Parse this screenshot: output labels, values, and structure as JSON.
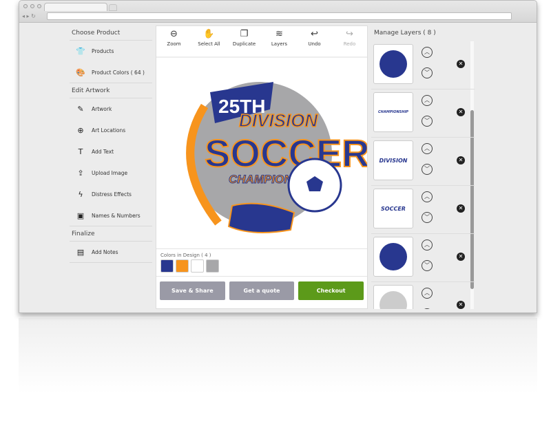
{
  "sidebar": {
    "sections": [
      {
        "title": "Choose Product",
        "items": [
          {
            "label": "Products",
            "icon": "tshirt-icon"
          },
          {
            "label": "Product Colors  ( 64 )",
            "icon": "palette-icon"
          }
        ]
      },
      {
        "title": "Edit Artwork",
        "items": [
          {
            "label": "Artwork",
            "icon": "brush-icon"
          },
          {
            "label": "Art Locations",
            "icon": "crosshair-icon"
          },
          {
            "label": "Add Text",
            "icon": "text-icon"
          },
          {
            "label": "Upload Image",
            "icon": "upload-icon"
          },
          {
            "label": "Distress Effects",
            "icon": "lightning-icon"
          },
          {
            "label": "Names & Numbers",
            "icon": "jersey-icon"
          }
        ]
      },
      {
        "title": "Finalize",
        "items": [
          {
            "label": "Add Notes",
            "icon": "notes-icon"
          }
        ]
      }
    ]
  },
  "toolbar": [
    {
      "label": "Zoom",
      "icon": "zoom-out-icon"
    },
    {
      "label": "Select All",
      "icon": "hand-icon"
    },
    {
      "label": "Duplicate",
      "icon": "duplicate-icon"
    },
    {
      "label": "Layers",
      "icon": "layers-icon"
    },
    {
      "label": "Undo",
      "icon": "undo-icon"
    },
    {
      "label": "Redo",
      "icon": "redo-icon",
      "disabled": true
    }
  ],
  "artwork": {
    "line1": "25TH",
    "line2": "DIVISION",
    "line3": "SOCCER",
    "line4": "CHAMPIONSHIP"
  },
  "colors": {
    "label": "Colors in Design ( 4 )",
    "swatches": [
      "#28378f",
      "#f7941d",
      "#ffffff",
      "#a7a7a9"
    ]
  },
  "buttons": {
    "save": "Save & Share",
    "quote": "Get a quote",
    "checkout": "Checkout"
  },
  "button_colors": {
    "secondary": "#9a9aa6",
    "checkout": "#5c9a1a"
  },
  "layers": {
    "title": "Manage Layers ( 8 )",
    "items": [
      "ball-cleat",
      "CHAMPIONSHIP",
      "DIVISION",
      "SOCCER",
      "banner",
      "swoosh"
    ]
  }
}
